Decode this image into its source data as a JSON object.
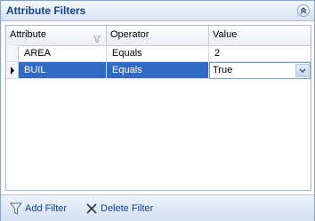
{
  "panel": {
    "title": "Attribute Filters"
  },
  "grid": {
    "columns": [
      "Attribute",
      "Operator",
      "Value"
    ],
    "rows": [
      {
        "attribute": "AREA",
        "operator": "Equals",
        "value": "2"
      },
      {
        "attribute": "BUIL",
        "operator": "Equals",
        "value": "True"
      }
    ]
  },
  "footer": {
    "add_label": "Add Filter",
    "delete_label": "Delete Filter"
  },
  "colors": {
    "title_text": "#15428b",
    "selection": "#316ac5",
    "border": "#8ba3c7"
  }
}
